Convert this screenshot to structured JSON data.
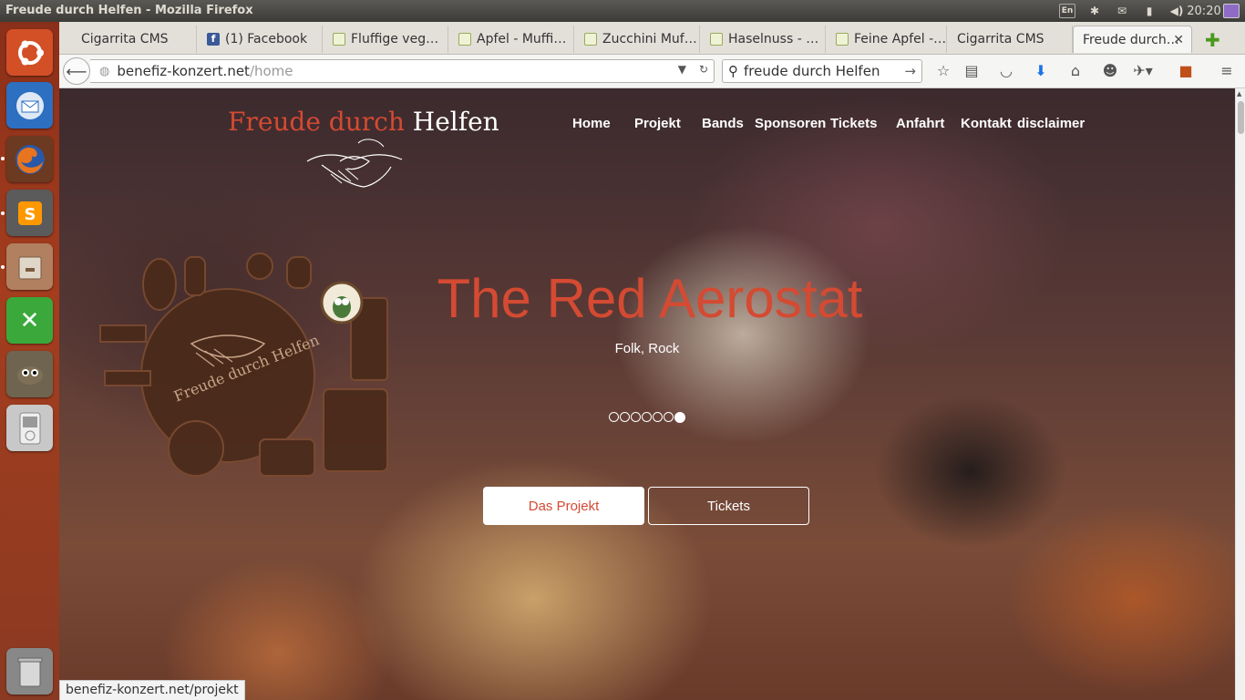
{
  "os": {
    "window_title": "Freude durch Helfen - Mozilla Firefox",
    "clock": "20:20",
    "tray_icons": [
      "keyboard-icon",
      "bluetooth-icon",
      "mail-icon",
      "battery-icon",
      "volume-icon",
      "session-icon"
    ]
  },
  "launcher": {
    "items": [
      {
        "name": "ubuntu-dash-icon",
        "color": "#d35027"
      },
      {
        "name": "thunderbird-icon",
        "color": "#2d6fc1"
      },
      {
        "name": "firefox-icon",
        "color": "#e8741f"
      },
      {
        "name": "sublime-text-icon",
        "color": "#5b5b5b"
      },
      {
        "name": "file-manager-icon",
        "color": "#b08060"
      },
      {
        "name": "xmind-icon",
        "color": "#3aa83a"
      },
      {
        "name": "gimp-icon",
        "color": "#6e6450"
      },
      {
        "name": "media-player-icon",
        "color": "#c8c8c8"
      },
      {
        "name": "trash-icon",
        "color": "#888888"
      }
    ]
  },
  "browser": {
    "tabs": [
      {
        "label": "Cigarrita CMS",
        "favicon": "none"
      },
      {
        "label": "(1) Facebook",
        "favicon": "facebook-icon"
      },
      {
        "label": "Fluffige veg…",
        "favicon": "leaf-icon"
      },
      {
        "label": "Apfel - Muffi…",
        "favicon": "leaf-icon"
      },
      {
        "label": "Zucchini Muf…",
        "favicon": "leaf-icon"
      },
      {
        "label": "Haselnuss - …",
        "favicon": "leaf-icon"
      },
      {
        "label": "Feine Apfel -…",
        "favicon": "leaf-icon"
      },
      {
        "label": "Cigarrita CMS",
        "favicon": "none"
      },
      {
        "label": "Freude durch…",
        "favicon": "none",
        "active": true
      }
    ],
    "url_host": "benefiz-konzert.net",
    "url_path": "/home",
    "search_value": "freude durch Helfen",
    "status_text": "benefiz-konzert.net/projekt"
  },
  "site": {
    "brand_part1": "Freude durch",
    "brand_part2": "Helfen",
    "nav": [
      "Home",
      "Projekt",
      "Bands",
      "Sponsoren",
      "Tickets",
      "Anfahrt",
      "Kontakt",
      "disclaimer"
    ],
    "logo_text": "Freude durch Helfen",
    "hero_title": "The Red Aerostat",
    "hero_subtitle": "Folk, Rock",
    "slides_total": 7,
    "slide_active": 7,
    "btn_primary": "Das Projekt",
    "btn_secondary": "Tickets",
    "accent": "#d44a32"
  }
}
